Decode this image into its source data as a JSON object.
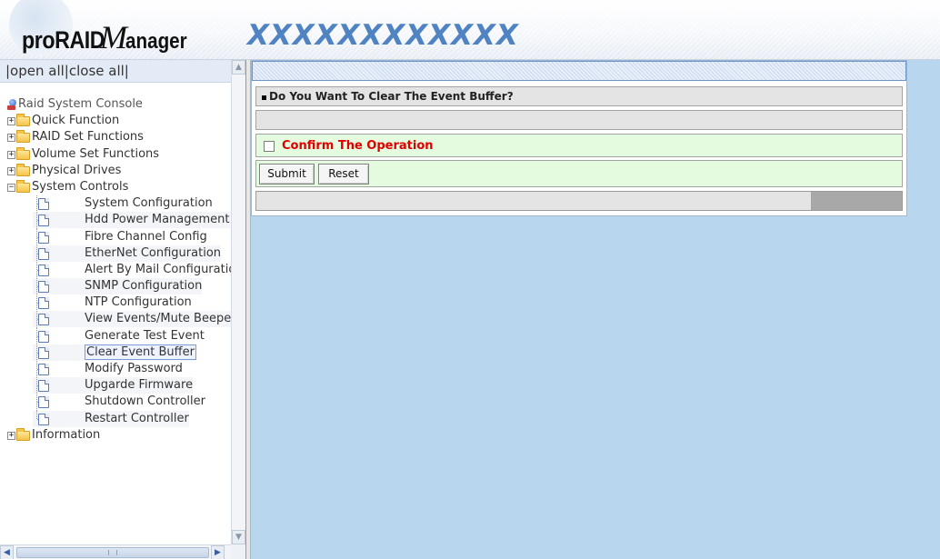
{
  "header": {
    "logo_pro": "proRAID",
    "logo_m": "M",
    "logo_anager": "anager",
    "host": "XXXXXXXXXXXX"
  },
  "tree": {
    "open_all": "|open all",
    "close_all": "|close all|",
    "root": "Raid System Console",
    "folders_top": [
      {
        "label": "Quick Function",
        "state": "collapsed"
      },
      {
        "label": "RAID Set Functions",
        "state": "collapsed"
      },
      {
        "label": "Volume Set Functions",
        "state": "collapsed"
      },
      {
        "label": "Physical Drives",
        "state": "collapsed"
      },
      {
        "label": "System Controls",
        "state": "expanded"
      }
    ],
    "system_controls_items": [
      "System Configuration",
      "Hdd Power Management",
      "Fibre Channel Config",
      "EtherNet Configuration",
      "Alert By Mail Configuration",
      "SNMP Configuration",
      "NTP Configuration",
      "View Events/Mute Beeper",
      "Generate Test Event",
      "Clear Event Buffer",
      "Modify Password",
      "Upgarde Firmware",
      "Shutdown Controller",
      "Restart Controller"
    ],
    "selected_item": "Clear Event Buffer",
    "folder_bottom": {
      "label": "Information",
      "state": "collapsed"
    }
  },
  "form": {
    "question": "Do You Want To Clear The Event Buffer?",
    "confirm_label": "Confirm The Operation",
    "confirm_checked": false,
    "submit_label": "Submit",
    "reset_label": "Reset",
    "progress_fraction": 0.86
  },
  "colors": {
    "content_bg": "#b8d6ee",
    "confirm_text": "#e00000",
    "host_text": "#4f83c1",
    "green_row": "#e5fbdf"
  }
}
